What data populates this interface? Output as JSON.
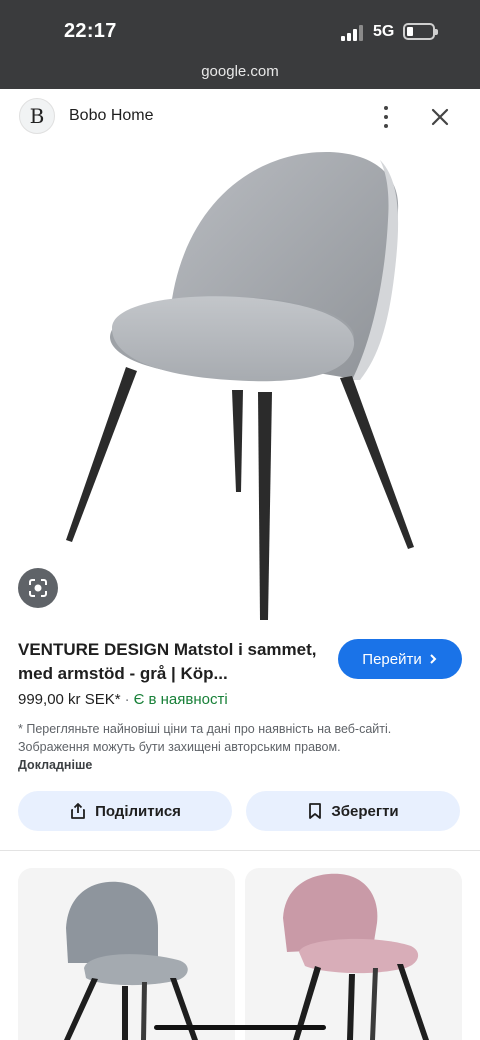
{
  "status_bar": {
    "time": "22:17",
    "network": "5G"
  },
  "browser": {
    "url": "google.com"
  },
  "source": {
    "logo_letter": "B",
    "name": "Bobo Home"
  },
  "product": {
    "title": "VENTURE DESIGN Matstol i sammet, med armstöd - grå | Köp...",
    "visit_button": "Перейти",
    "price": "999,00 kr SEK*",
    "separator": "·",
    "stock": "Є в наявності",
    "disclaimer": "* Перегляньте найновіші ціни та дані про наявність на веб-сайті. Зображення можуть бути захищені авторським правом.",
    "disclaimer_link": "Докладніше"
  },
  "actions": {
    "share": "Поділитися",
    "save": "Зберегти"
  },
  "colors": {
    "accent": "#1a73e8",
    "in_stock": "#188038",
    "pill_bg": "#e8f0fe"
  },
  "icons": [
    "more-vert-icon",
    "close-icon",
    "lens-icon",
    "share-icon",
    "bookmark-icon",
    "chevron-right-icon"
  ]
}
